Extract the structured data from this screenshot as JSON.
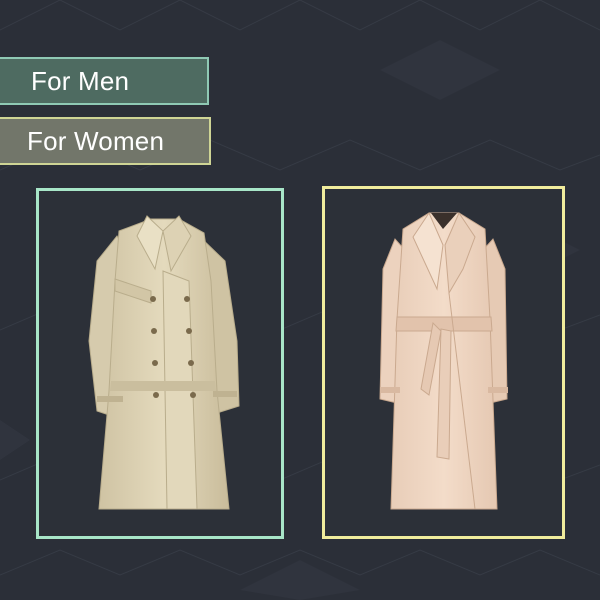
{
  "categories": {
    "men_label": "For Men",
    "women_label": "For Women"
  },
  "products": [
    {
      "icon": "mens-trench-coat-image"
    },
    {
      "icon": "womens-trench-coat-image"
    }
  ],
  "colors": {
    "background": "#2b2f38",
    "men_button_bg": "#4e6b61",
    "men_accent": "#a8e6c8",
    "women_button_bg": "#72766a",
    "women_accent": "#f0ec9c"
  }
}
